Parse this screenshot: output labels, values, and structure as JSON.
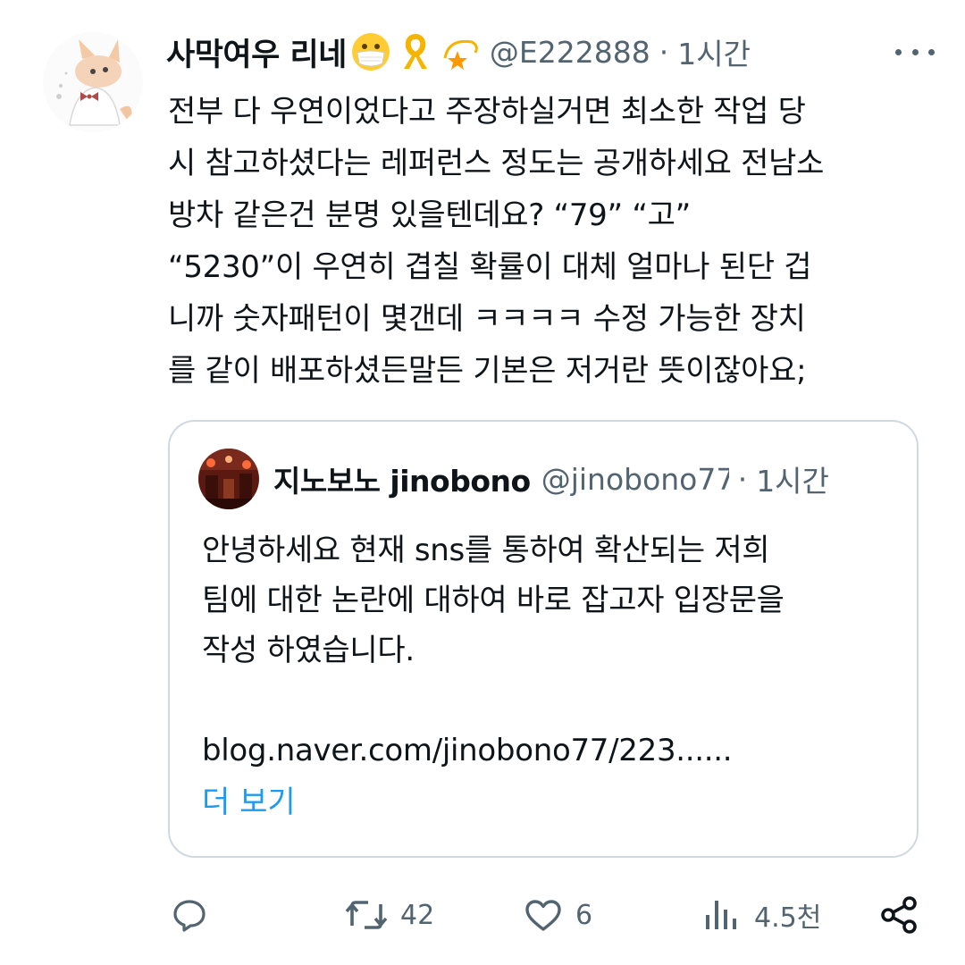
{
  "tweet": {
    "display_name": "사막여우 리네",
    "emojis": [
      "mask-face-emoji",
      "yellow-ribbon-emoji",
      "dizzy-star-emoji"
    ],
    "handle": "@E222888",
    "separator": "·",
    "time": "1시간",
    "text_lines": [
      "전부 다 우연이었다고 주장하실거면 최소한 작업 당",
      "시 참고하셨다는 레퍼런스 정도는 공개하세요 전남소",
      "방차 같은건 분명 있을텐데요? “79” “고”",
      "“5230”이 우연히 겹칠 확률이 대체 얼마나 된단 겁",
      "니까 숫자패턴이 몇갠데 ㅋㅋㅋㅋ 수정 가능한 장치",
      "를 같이 배포하셨든말든 기본은 저거란 뜻이잖아요;"
    ]
  },
  "quote": {
    "display_name": "지노보노 jinobono",
    "handle": "@jinobono77",
    "separator": "·",
    "time": "1시간",
    "text_lines": [
      "안녕하세요 현재 sns를 통하여 확산되는 저희",
      "팀에 대한 논란에 대하여 바로 잡고자 입장문을",
      "작성 하였습니다.",
      "",
      "blog.naver.com/jinobono77/223......"
    ],
    "show_more": "더 보기"
  },
  "actions": {
    "reply_count": "",
    "retweet_count": "42",
    "like_count": "6",
    "views_count": "4.5천"
  },
  "colors": {
    "text": "#0f1419",
    "secondary": "#536471",
    "link": "#1d9bf0",
    "border": "#cfd9de"
  }
}
